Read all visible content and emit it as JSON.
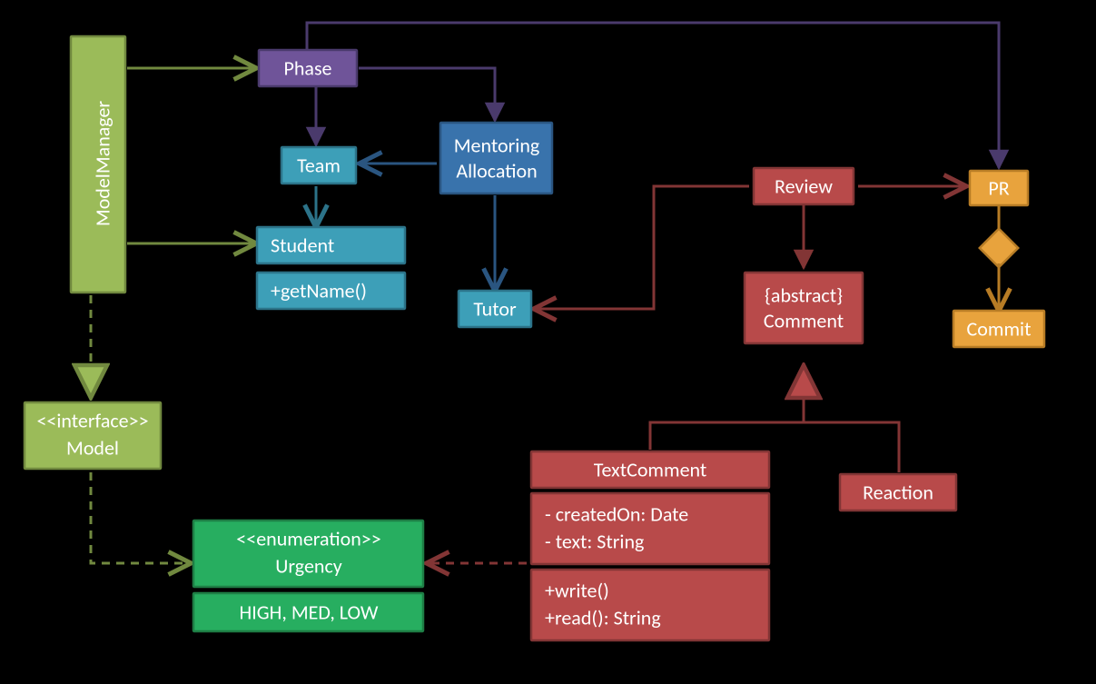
{
  "nodes": {
    "modelmanager": {
      "label": "ModelManager"
    },
    "model": {
      "stereotype": "<<interface>>",
      "label": "Model"
    },
    "urgency": {
      "stereotype": "<<enumeration>>",
      "label": "Urgency",
      "values": "HIGH, MED, LOW"
    },
    "phase": {
      "label": "Phase"
    },
    "team": {
      "label": "Team"
    },
    "student": {
      "label": "Student",
      "method": "+getName()"
    },
    "mentoring": {
      "line1": "Mentoring",
      "line2": "Allocation"
    },
    "tutor": {
      "label": "Tutor"
    },
    "review": {
      "label": "Review"
    },
    "comment": {
      "line1": "{abstract}",
      "line2": "Comment"
    },
    "textcomment": {
      "label": "TextComment",
      "attr1": "- createdOn: Date",
      "attr2": "- text: String",
      "m1": "+write()",
      "m2": "+read(): String"
    },
    "reaction": {
      "label": "Reaction"
    },
    "pr": {
      "label": "PR"
    },
    "commit": {
      "label": "Commit"
    }
  },
  "colors": {
    "olive_fill": "#9BBB59",
    "olive_stroke": "#71893F",
    "green_fill": "#27AE60",
    "green_stroke": "#1E7E45",
    "purple_fill": "#6F5499",
    "purple_stroke": "#4A3A6C",
    "teal_fill": "#3D9FB8",
    "teal_stroke": "#2C7389",
    "blue_fill": "#3973AC",
    "blue_stroke": "#2A5580",
    "red_fill": "#B84A4A",
    "red_stroke": "#823535",
    "orange_fill": "#E8A33D",
    "orange_stroke": "#B77C25"
  },
  "chart_data": {
    "type": "diagram",
    "nodes": [
      {
        "id": "ModelManager",
        "stereotype": null
      },
      {
        "id": "Model",
        "stereotype": "interface"
      },
      {
        "id": "Urgency",
        "stereotype": "enumeration",
        "literals": [
          "HIGH",
          "MED",
          "LOW"
        ]
      },
      {
        "id": "Phase"
      },
      {
        "id": "Team"
      },
      {
        "id": "Student",
        "methods": [
          "+getName()"
        ]
      },
      {
        "id": "MentoringAllocation"
      },
      {
        "id": "Tutor"
      },
      {
        "id": "Review"
      },
      {
        "id": "Comment",
        "modifier": "abstract"
      },
      {
        "id": "TextComment",
        "attributes": [
          "- createdOn: Date",
          "- text: String"
        ],
        "methods": [
          "+write()",
          "+read(): String"
        ]
      },
      {
        "id": "Reaction"
      },
      {
        "id": "PR"
      },
      {
        "id": "Commit"
      }
    ],
    "edges": [
      {
        "from": "ModelManager",
        "to": "Phase",
        "style": "solid",
        "head": "open"
      },
      {
        "from": "ModelManager",
        "to": "Student",
        "style": "solid",
        "head": "open"
      },
      {
        "from": "ModelManager",
        "to": "Model",
        "style": "dashed",
        "head": "hollow-triangle",
        "relation": "realization"
      },
      {
        "from": "Model",
        "to": "Urgency",
        "style": "dashed",
        "head": "open"
      },
      {
        "from": "Phase",
        "to": "Team",
        "style": "solid",
        "head": "filled"
      },
      {
        "from": "Phase",
        "to": "MentoringAllocation",
        "style": "solid",
        "head": "filled"
      },
      {
        "from": "Phase",
        "to": "PR",
        "style": "solid",
        "head": "filled"
      },
      {
        "from": "Team",
        "to": "Student",
        "style": "solid",
        "head": "open"
      },
      {
        "from": "MentoringAllocation",
        "to": "Team",
        "style": "solid",
        "head": "open"
      },
      {
        "from": "MentoringAllocation",
        "to": "Tutor",
        "style": "solid",
        "head": "open"
      },
      {
        "from": "Review",
        "to": "Tutor",
        "style": "solid",
        "head": "open"
      },
      {
        "from": "Review",
        "to": "PR",
        "style": "solid",
        "head": "open"
      },
      {
        "from": "Review",
        "to": "Comment",
        "style": "solid",
        "head": "filled"
      },
      {
        "from": "TextComment",
        "to": "Comment",
        "style": "solid",
        "head": "hollow-triangle",
        "relation": "generalization"
      },
      {
        "from": "Reaction",
        "to": "Comment",
        "style": "solid",
        "head": "hollow-triangle",
        "relation": "generalization"
      },
      {
        "from": "TextComment",
        "to": "Urgency",
        "style": "dashed",
        "head": "open"
      },
      {
        "from": "PR",
        "to": "Commit",
        "style": "solid",
        "head": "open",
        "via": "aggregation-diamond"
      }
    ]
  }
}
